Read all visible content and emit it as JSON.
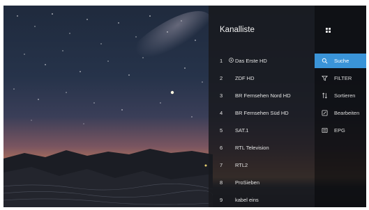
{
  "channel_list": {
    "title": "Kanalliste",
    "channels": [
      {
        "number": "1",
        "name": "Das Erste HD",
        "playing": true
      },
      {
        "number": "2",
        "name": "ZDF HD"
      },
      {
        "number": "3",
        "name": "BR Fernsehen Nord HD"
      },
      {
        "number": "4",
        "name": "BR Fernsehen Süd HD"
      },
      {
        "number": "5",
        "name": "SAT.1"
      },
      {
        "number": "6",
        "name": "RTL Television"
      },
      {
        "number": "7",
        "name": "RTL2"
      },
      {
        "number": "8",
        "name": "ProSieben"
      },
      {
        "number": "9",
        "name": "kabel eins"
      }
    ]
  },
  "side_menu": {
    "top_icon": "grid-icon",
    "items": [
      {
        "label": "Suche",
        "icon": "search-icon",
        "active": true
      },
      {
        "label": "FILTER",
        "icon": "filter-icon"
      },
      {
        "label": "Sortieren",
        "icon": "sort-icon"
      },
      {
        "label": "Bearbeiten",
        "icon": "edit-icon"
      },
      {
        "label": "EPG",
        "icon": "epg-icon"
      }
    ]
  },
  "colors": {
    "accent": "#3a94d8",
    "panel_bg": "#181a1e",
    "side_bg": "#0e0f12"
  }
}
